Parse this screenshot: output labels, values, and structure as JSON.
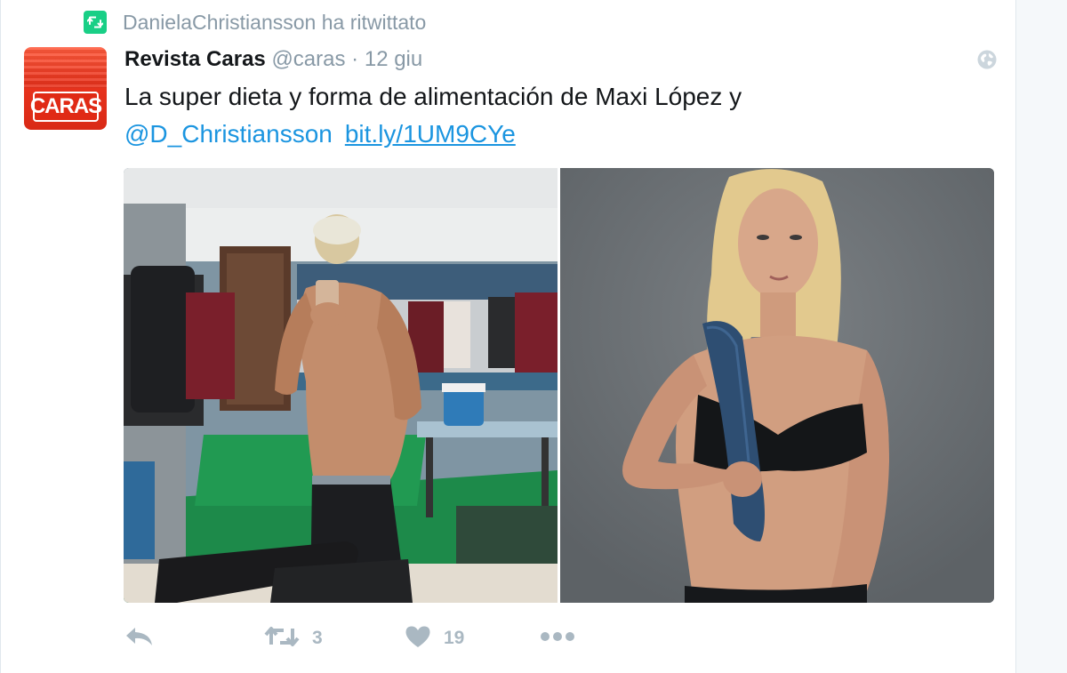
{
  "context": {
    "text": "DanielaChristiansson ha ritwittato",
    "icon": "retweet-icon"
  },
  "tweet": {
    "avatar": {
      "logo_text": "CARAS"
    },
    "author_name": "Revista Caras",
    "author_handle": "@caras",
    "separator": "·",
    "timestamp": "12 giu",
    "text_line1": "La super dieta y forma de alimentación de Maxi López y",
    "mention": "@D_Christiansson",
    "link": "bit.ly/1UM9CYe",
    "globe_icon": "globe-icon"
  },
  "actions": {
    "reply_icon": "reply-icon",
    "retweet_icon": "retweet-icon",
    "retweet_count": "3",
    "like_icon": "heart-icon",
    "like_count": "19",
    "more_icon": "more-dots-icon"
  },
  "colors": {
    "link": "#1b95e0",
    "muted": "#8899a6",
    "action_grey": "#aab8c2",
    "retweet_green": "#19cf86",
    "text": "#14171a"
  }
}
